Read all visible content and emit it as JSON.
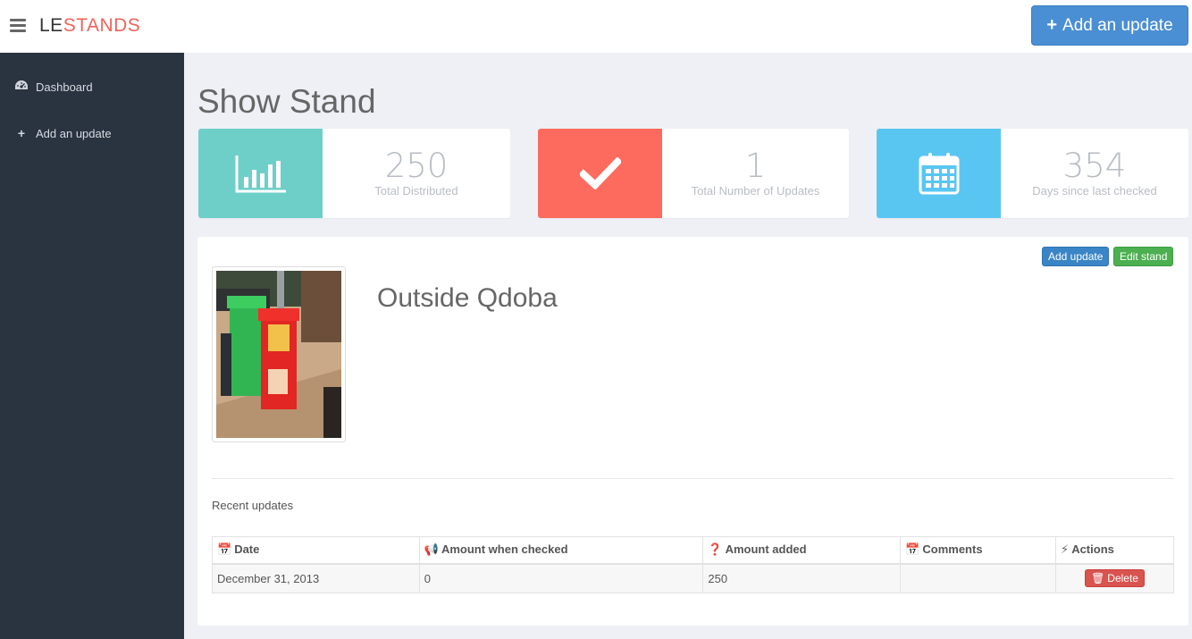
{
  "topbar": {
    "brand_part1": "LE",
    "brand_part2": "STANDS",
    "add_button_label": "Add an update"
  },
  "sidebar": {
    "items": [
      {
        "label": "Dashboard",
        "icon": "dashboard-icon"
      },
      {
        "label": "Add an update",
        "icon": "plus-icon"
      }
    ]
  },
  "page": {
    "title": "Show Stand"
  },
  "stats": [
    {
      "value": "250",
      "label": "Total Distributed",
      "icon": "bar-chart-icon",
      "color": "#6ecfc9"
    },
    {
      "value": "1",
      "label": "Total Number of Updates",
      "icon": "checkmark-icon",
      "color": "#fd6b5e"
    },
    {
      "value": "354",
      "label": "Days since last checked",
      "icon": "calendar-icon",
      "color": "#59c6f2"
    }
  ],
  "stand": {
    "name": "Outside Qdoba",
    "add_update_label": "Add update",
    "edit_stand_label": "Edit stand",
    "recent_label": "Recent updates"
  },
  "table": {
    "headers": [
      {
        "label": "Date",
        "icon": "calendar-icon"
      },
      {
        "label": "Amount when checked",
        "icon": "bullhorn-icon"
      },
      {
        "label": "Amount added",
        "icon": "question-circle-icon"
      },
      {
        "label": "Comments",
        "icon": "calendar-icon"
      },
      {
        "label": "Actions",
        "icon": "bolt-icon"
      }
    ],
    "rows": [
      {
        "date": "December 31, 2013",
        "amount_checked": "0",
        "amount_added": "250",
        "comments": "",
        "action_label": "Delete"
      }
    ]
  },
  "colors": {
    "brand_accent": "#f0635a",
    "primary": "#4a8fd4",
    "success": "#4caf50",
    "danger": "#d9534f",
    "sidebar_bg": "#2a3340"
  }
}
